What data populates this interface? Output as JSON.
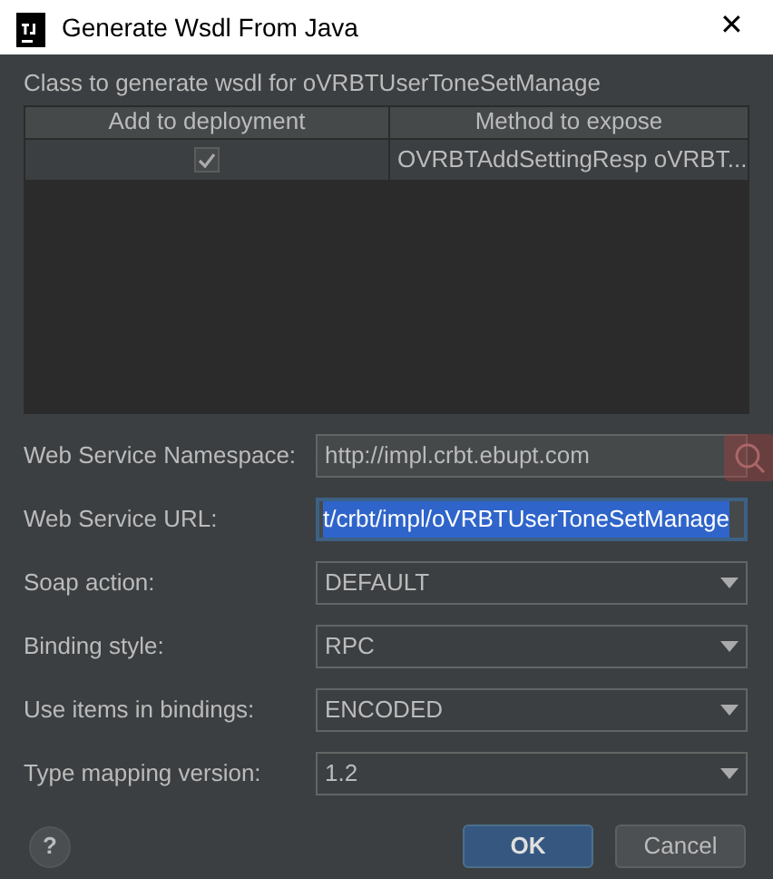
{
  "window": {
    "title": "Generate Wsdl From Java",
    "close": "✕"
  },
  "class_label": "Class to generate wsdl for oVRBTUserToneSetManage",
  "table": {
    "columns": [
      "Add to deployment",
      "Method to expose"
    ],
    "rows": [
      {
        "checked": true,
        "method": "OVRBTAddSettingResp oVRBT..."
      }
    ]
  },
  "fields": [
    {
      "label": "Web Service Namespace:",
      "kind": "text",
      "value": "http://impl.crbt.ebupt.com",
      "focused": false
    },
    {
      "label": "Web Service URL:",
      "kind": "text",
      "value": "t/crbt/impl/oVRBTUserToneSetManage",
      "focused": true
    },
    {
      "label": "Soap action:",
      "kind": "dropdown",
      "value": "DEFAULT"
    },
    {
      "label": "Binding style:",
      "kind": "dropdown",
      "value": "RPC"
    },
    {
      "label": "Use items in bindings:",
      "kind": "dropdown",
      "value": "ENCODED"
    },
    {
      "label": "Type mapping version:",
      "kind": "dropdown",
      "value": "1.2"
    }
  ],
  "help": "?",
  "buttons": [
    {
      "label": "OK",
      "primary": true
    },
    {
      "label": "Cancel",
      "primary": false
    }
  ]
}
